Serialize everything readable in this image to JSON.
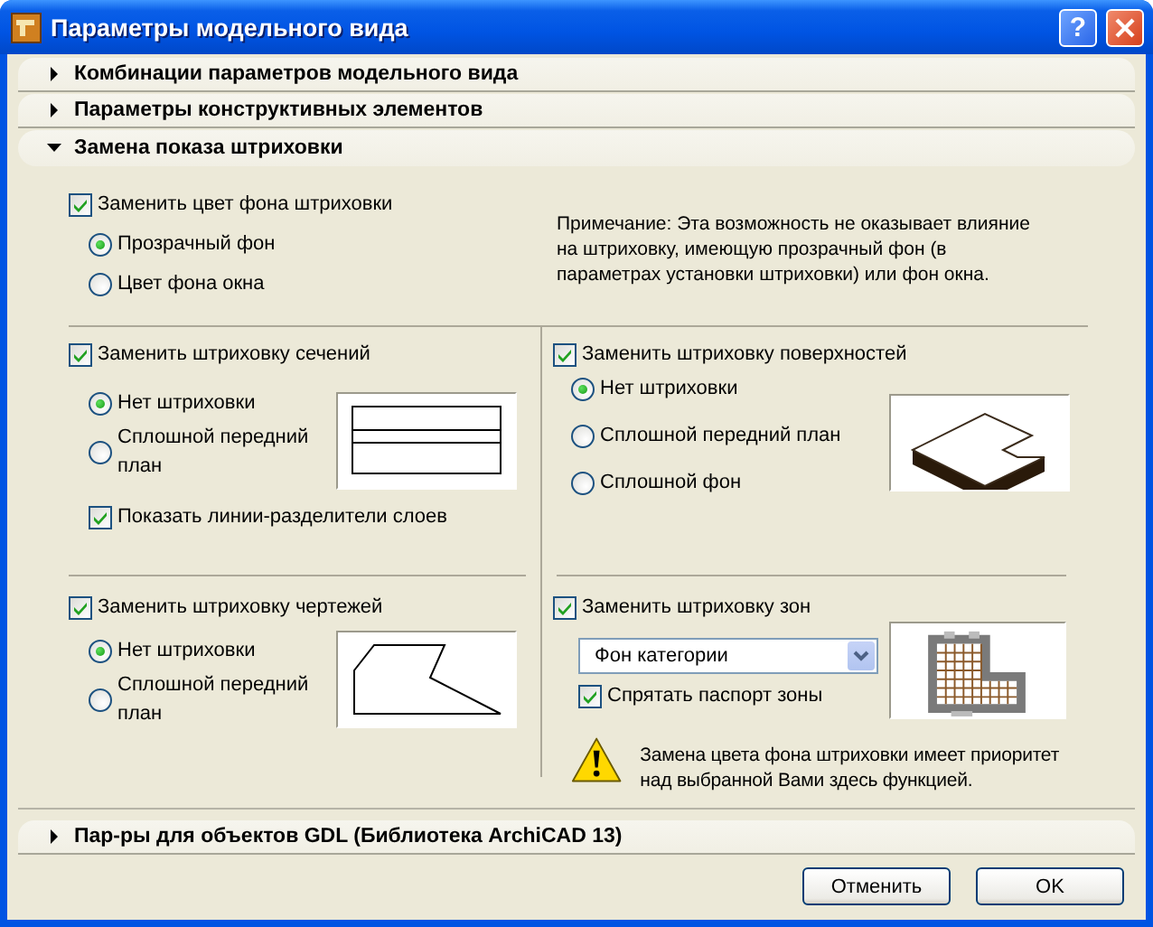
{
  "window": {
    "title": "Параметры модельного вида",
    "help": "?"
  },
  "sections": [
    {
      "label": "Комбинации параметров модельного вида",
      "expanded": false
    },
    {
      "label": "Параметры конструктивных элементов",
      "expanded": false
    },
    {
      "label": "Замена показа штриховки",
      "expanded": true
    }
  ],
  "background": {
    "checkbox": {
      "label": "Заменить цвет фона штриховки",
      "checked": true
    },
    "options": [
      {
        "label": "Прозрачный фон",
        "selected": true
      },
      {
        "label": "Цвет фона окна",
        "selected": false
      }
    ],
    "note": "Примечание: Эта возможность не оказывает влияние на штриховку, имеющую прозрачный фон (в параметрах установки штриховки) или фон окна."
  },
  "cut_fills": {
    "checkbox": {
      "label": "Заменить штриховку сечений",
      "checked": true
    },
    "options": [
      {
        "label": "Нет штриховки",
        "selected": true
      },
      {
        "label": "Сплошной передний план",
        "selected": false
      }
    ],
    "separator_lines": {
      "label": "Показать линии-разделители слоев",
      "checked": true
    }
  },
  "cover_fills": {
    "checkbox": {
      "label": "Заменить штриховку поверхностей",
      "checked": true
    },
    "options": [
      {
        "label": "Нет штриховки",
        "selected": true
      },
      {
        "label": "Сплошной передний план",
        "selected": false
      },
      {
        "label": "Сплошной фон",
        "selected": false
      }
    ]
  },
  "drafting_fills": {
    "checkbox": {
      "label": "Заменить штриховку чертежей",
      "checked": true
    },
    "options": [
      {
        "label": "Нет штриховки",
        "selected": true
      },
      {
        "label": "Сплошной передний план",
        "selected": false
      }
    ]
  },
  "zone_fills": {
    "checkbox": {
      "label": "Заменить штриховку зон",
      "checked": true
    },
    "dropdown": {
      "value": "Фон категории"
    },
    "hide_stamp": {
      "label": "Спрятать паспорт зоны",
      "checked": true
    },
    "warning": "Замена цвета фона штриховки имеет приоритет над выбранной Вами здесь функцией."
  },
  "gdl_section": {
    "label": "Пар-ры для объектов GDL (Библиотека ArchiCAD 13)",
    "expanded": false
  },
  "buttons": [
    "Отменить",
    "OK"
  ]
}
